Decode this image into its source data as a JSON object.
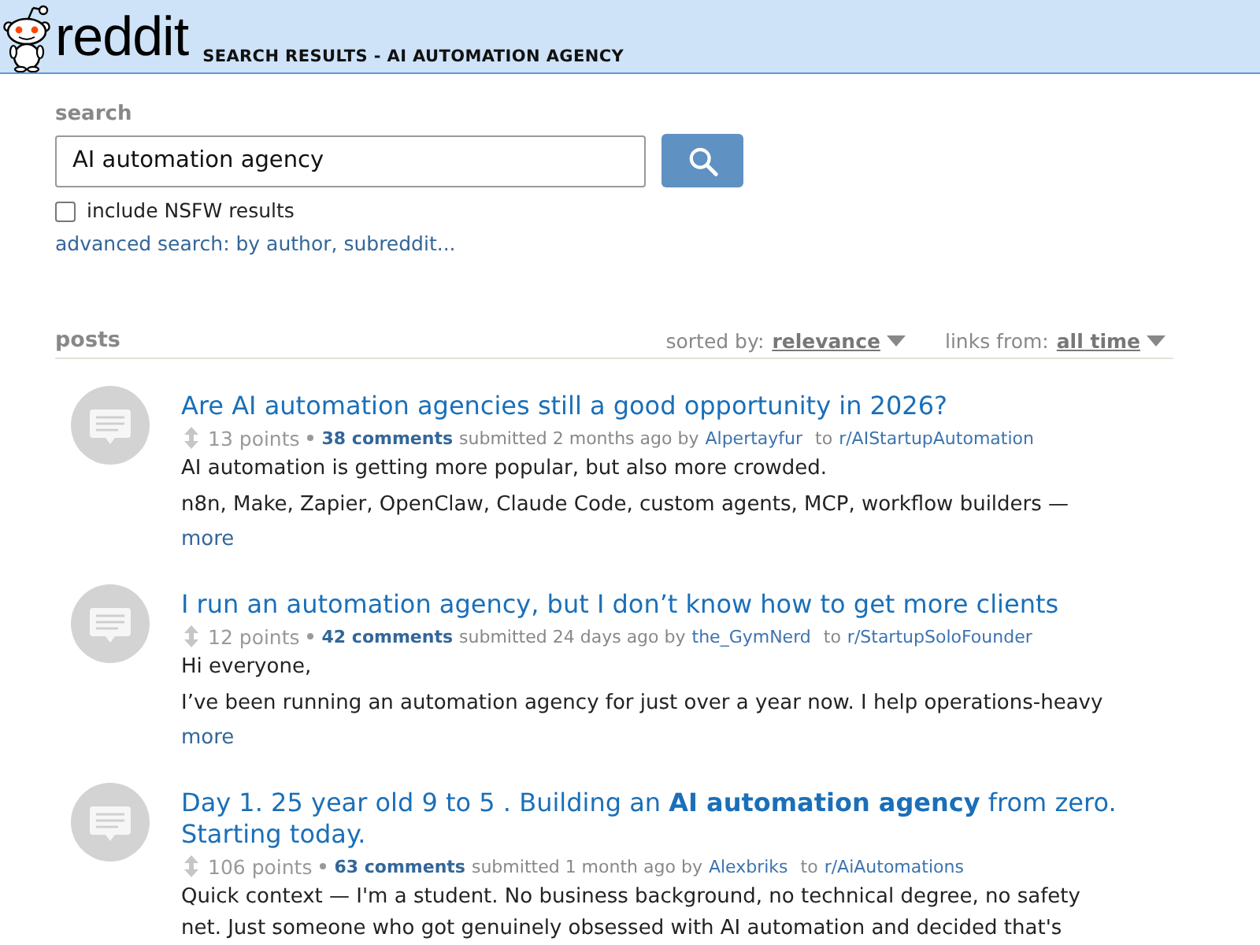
{
  "header": {
    "logo_text": "reddit",
    "page_title": "SEARCH RESULTS - AI AUTOMATION AGENCY"
  },
  "search": {
    "label": "search",
    "value": "AI automation agency",
    "nsfw": {
      "label": "include NSFW results",
      "checked": false
    },
    "advanced_link": "advanced search: by author, subreddit..."
  },
  "posts_header": {
    "title": "posts",
    "sort": {
      "label": "sorted by:",
      "value": "relevance"
    },
    "time": {
      "label": "links from:",
      "value": "all time"
    }
  },
  "posts": [
    {
      "title": "Are AI automation agencies still a good opportunity in 2026?",
      "points": "13 points",
      "comments": "38 comments",
      "submitted": "submitted 2 months ago by",
      "author": "Alpertayfur",
      "to": "to",
      "subreddit": "r/AIStartupAutomation",
      "body": [
        "AI automation is getting more popular, but also more crowded.",
        "n8n, Make, Zapier, OpenClaw, Claude Code, custom agents, MCP, workflow builders —"
      ],
      "more": "more"
    },
    {
      "title": "I run an automation agency, but I don’t know how to get more clients",
      "points": "12 points",
      "comments": "42 comments",
      "submitted": "submitted 24 days ago by",
      "author": "the_GymNerd",
      "to": "to",
      "subreddit": "r/StartupSoloFounder",
      "body": [
        "Hi everyone,",
        "I’ve been running an automation agency for just over a year now. I help operations-heavy"
      ],
      "more": "more"
    },
    {
      "title": "Day 1. 25 year old 9 to 5 . Building an **AI automation agency** from zero. Starting today.",
      "points": "106 points",
      "comments": "63 comments",
      "submitted": "submitted 1 month ago by",
      "author": "Alexbriks",
      "to": "to",
      "subreddit": "r/AiAutomations",
      "body": [
        "Quick context — I'm a student. No business background, no technical degree, no safety net. Just someone who got genuinely obsessed with AI automation and decided that's"
      ]
    }
  ]
}
